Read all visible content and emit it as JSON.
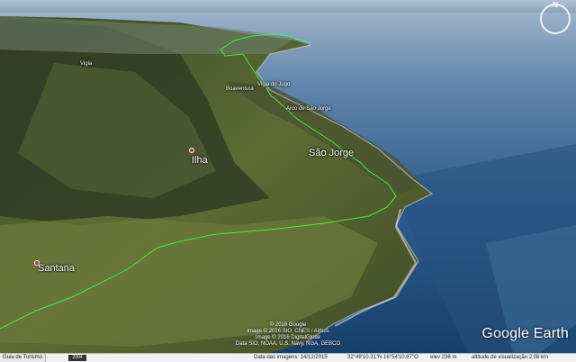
{
  "places": {
    "santana": "Santana",
    "ilha": "Ilha",
    "sao_jorge": "São Jorge",
    "arco_sao_jorge": "Arco de São Jorge",
    "boaventura": "Boaventura",
    "vigia": "Vigia",
    "small_label": "Vigia do Jogo"
  },
  "credits": {
    "line1": "© 2016 Google",
    "line2": "Image © 2016 SIO, CNES / Airbus",
    "line3": "Image © 2016 DigitalGlobe",
    "line4": "Data SIO, NOAA, U.S. Navy, NGA, GEBCO"
  },
  "logo": "Google Earth",
  "statusbar": {
    "tour_label": "Guia de Turismo",
    "year": "2004",
    "imagery_date": "Data das imagens: 14/12/2015",
    "coordinates": "32°49'10.31\"N   16°54'10.87\"O",
    "elevation": "elev   236 m",
    "eye_altitude": "altitude de visualização   2.08 km"
  },
  "compass_north": "N",
  "colors": {
    "trail": "#3cff3c",
    "sea_deep": "#1e4a78",
    "sea_shallow": "#3f7fb0",
    "land_dark": "#2e3b22",
    "land_light": "#6f7a3a"
  }
}
